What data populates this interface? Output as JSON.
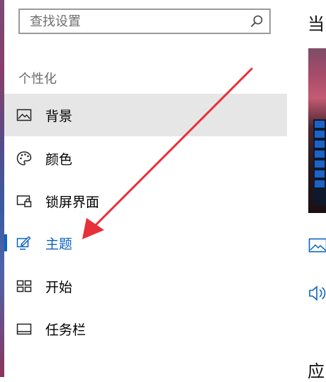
{
  "search": {
    "placeholder": "查找设置",
    "icon": "search-icon"
  },
  "section": {
    "title": "个性化"
  },
  "nav": {
    "items": [
      {
        "label": "背景",
        "icon": "picture-icon",
        "state": "selected"
      },
      {
        "label": "颜色",
        "icon": "palette-icon",
        "state": "normal"
      },
      {
        "label": "锁屏界面",
        "icon": "lock-screen-icon",
        "state": "normal"
      },
      {
        "label": "主题",
        "icon": "theme-brush-icon",
        "state": "active"
      },
      {
        "label": "开始",
        "icon": "start-grid-icon",
        "state": "normal"
      },
      {
        "label": "任务栏",
        "icon": "taskbar-icon",
        "state": "normal"
      }
    ]
  },
  "right_pane": {
    "heading_fragment": "当",
    "footer_fragment": "应"
  },
  "colors": {
    "accent": "#0a63c2",
    "selected_bg": "#e6e6e6",
    "annotation_arrow": "#e8303a"
  }
}
